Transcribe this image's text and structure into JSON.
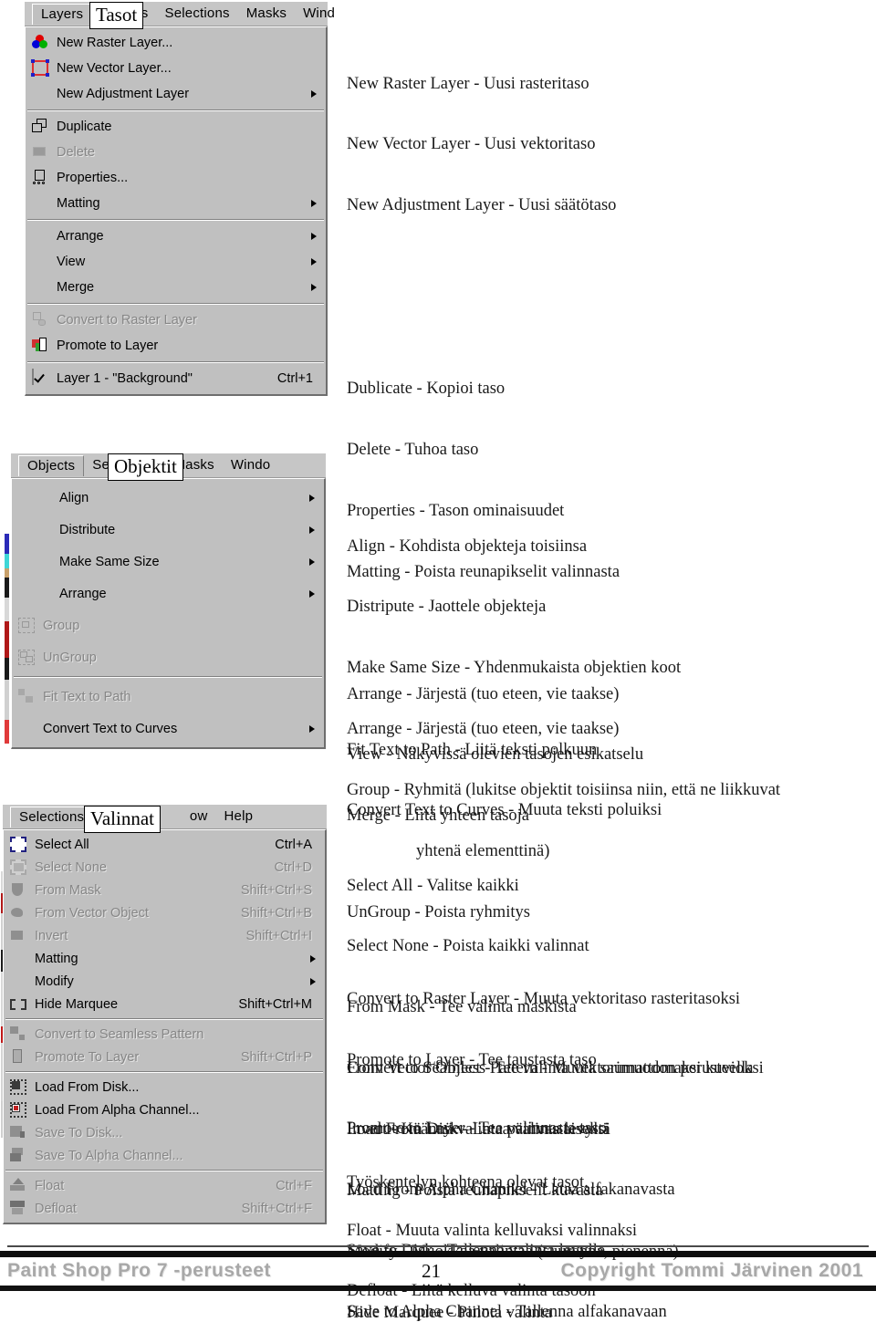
{
  "page": {
    "footer": {
      "left": "Paint Shop Pro 7 -perusteet",
      "page_number": "21",
      "right": "Copyright Tommi Järvinen 2001"
    }
  },
  "menus": [
    {
      "id": "layers",
      "menubar": {
        "items": [
          {
            "label": "Layers",
            "accel": "L",
            "active": true
          },
          {
            "label": "Objects",
            "accel": "O",
            "active": false
          },
          {
            "label": "Selections",
            "accel": "S",
            "active": false
          },
          {
            "label": "Masks",
            "accel": "M",
            "active": false
          },
          {
            "label": "Wind",
            "accel": "W",
            "active": false
          }
        ],
        "annotation": "Tasot"
      },
      "items": [
        {
          "label": "New Raster Layer...",
          "accel": "L",
          "icon": "raster-layer-icon",
          "shortcut": "",
          "submenu": false,
          "disabled": false
        },
        {
          "label": "New Vector Layer...",
          "accel": "V",
          "icon": "vector-layer-icon",
          "shortcut": "",
          "submenu": false,
          "disabled": false
        },
        {
          "label": "New Adjustment Layer",
          "accel": "A",
          "icon": "",
          "shortcut": "",
          "submenu": true,
          "disabled": false
        },
        {
          "separator": true
        },
        {
          "label": "Duplicate",
          "accel": "u",
          "icon": "duplicate-icon",
          "shortcut": "",
          "submenu": false,
          "disabled": false
        },
        {
          "label": "Delete",
          "accel": "D",
          "icon": "delete-icon",
          "shortcut": "",
          "submenu": false,
          "disabled": true
        },
        {
          "label": "Properties...",
          "accel": "P",
          "icon": "properties-icon",
          "shortcut": "",
          "submenu": false,
          "disabled": false
        },
        {
          "label": "Matting",
          "accel": "t",
          "icon": "",
          "shortcut": "",
          "submenu": true,
          "disabled": false
        },
        {
          "separator": true
        },
        {
          "label": "Arrange",
          "accel": "n",
          "icon": "",
          "shortcut": "",
          "submenu": true,
          "disabled": false
        },
        {
          "label": "View",
          "accel": "w",
          "icon": "",
          "shortcut": "",
          "submenu": true,
          "disabled": false
        },
        {
          "label": "Merge",
          "accel": "r",
          "icon": "",
          "shortcut": "",
          "submenu": true,
          "disabled": false
        },
        {
          "separator": true
        },
        {
          "label": "Convert to Raster Layer",
          "accel": "C",
          "icon": "convert-raster-icon",
          "shortcut": "",
          "submenu": false,
          "disabled": true
        },
        {
          "label": "Promote to Layer",
          "accel": "o",
          "icon": "promote-layer-icon",
          "shortcut": "",
          "submenu": false,
          "disabled": false
        },
        {
          "separator": true
        },
        {
          "label": "Layer 1 - \"Background\"",
          "accel": "1",
          "icon": "checkmark",
          "shortcut": "Ctrl+1",
          "submenu": false,
          "disabled": false
        }
      ],
      "descriptions": [
        "New Raster Layer - Uusi rasteritaso",
        "New Vector Layer - Uusi vektoritaso",
        "New Adjustment Layer - Uusi säätötaso",
        "",
        "",
        "Dublicate - Kopioi taso",
        "Delete - Tuhoa taso",
        "Properties - Tason ominaisuudet",
        "Matting - Poista reunapikselit valinnasta",
        "",
        "Arrange - Järjestä (tuo eteen, vie taakse)",
        "View - Näkyvissä olevien tasojen esikatselu",
        "Merge - Liitä yhteen tasoja",
        "",
        "",
        "Convert to Raster Layer - Muuta vektoritaso rasteritasoksi",
        "Promote to Layer - Tee taustasta taso",
        "",
        "Työskentelyn kohteena olevat tasot."
      ]
    },
    {
      "id": "objects",
      "menubar": {
        "items": [
          {
            "label": "Objects",
            "accel": "O",
            "active": true
          },
          {
            "label": "Selections",
            "accel": "g",
            "active": false
          },
          {
            "label": "Masks",
            "accel": "M",
            "active": false
          },
          {
            "label": "Windo",
            "accel": "W",
            "active": false
          }
        ],
        "annotation": "Objektit"
      },
      "items": [
        {
          "label": "Align",
          "accel": "A",
          "icon": "",
          "shortcut": "",
          "submenu": true,
          "disabled": false
        },
        {
          "label": "Distribute",
          "accel": "D",
          "icon": "",
          "shortcut": "",
          "submenu": true,
          "disabled": false
        },
        {
          "label": "Make Same Size",
          "accel": "z",
          "icon": "",
          "shortcut": "",
          "submenu": true,
          "disabled": false
        },
        {
          "label": "Arrange",
          "accel": "n",
          "icon": "",
          "shortcut": "",
          "submenu": true,
          "disabled": false
        },
        {
          "label": "Group",
          "accel": "G",
          "icon": "group-icon",
          "shortcut": "",
          "submenu": false,
          "disabled": true
        },
        {
          "label": "UnGroup",
          "accel": "U",
          "icon": "ungroup-icon",
          "shortcut": "",
          "submenu": false,
          "disabled": true
        },
        {
          "separator": true
        },
        {
          "label": "Fit Text to Path",
          "accel": "F",
          "icon": "fit-text-icon",
          "shortcut": "",
          "submenu": false,
          "disabled": true
        },
        {
          "label": "Convert Text to Curves",
          "accel": "o",
          "icon": "",
          "shortcut": "",
          "submenu": true,
          "disabled": false
        }
      ],
      "descriptions": [
        "Align - Kohdista objekteja toisiinsa",
        "Distripute - Jaottele objekteja",
        "Make Same Size - Yhdenmukaista objektien koot",
        "Arrange - Järjestä (tuo eteen, vie taakse)",
        "Group - Ryhmitä (lukitse objektit toisiinsa niin, että ne liikkuvat",
        "yhtenä elementtinä)",
        "UnGroup - Poista ryhmitys"
      ],
      "descriptions2": [
        "Fit Text to Path - Liitä teksti polkuun",
        "Convert Text to Curves - Muuta teksti poluiksi"
      ]
    },
    {
      "id": "selections",
      "menubar": {
        "items": [
          {
            "label": "Selections",
            "accel": "S",
            "active": true
          },
          {
            "label": "M",
            "accel": "M",
            "active": false
          },
          {
            "label": "ow",
            "accel": "",
            "active": false
          },
          {
            "label": "Help",
            "accel": "H",
            "active": false
          }
        ],
        "annotation": "Valinnat"
      },
      "items": [
        {
          "label": "Select All",
          "accel": "A",
          "icon": "select-all-icon",
          "shortcut": "Ctrl+A",
          "submenu": false,
          "disabled": false
        },
        {
          "label": "Select None",
          "accel": "N",
          "icon": "select-none-icon",
          "shortcut": "Ctrl+D",
          "submenu": false,
          "disabled": true
        },
        {
          "label": "From Mask",
          "accel": "r",
          "icon": "from-mask-icon",
          "shortcut": "Shift+Ctrl+S",
          "submenu": false,
          "disabled": true
        },
        {
          "label": "From Vector Object",
          "accel": "",
          "icon": "from-vector-icon",
          "shortcut": "Shift+Ctrl+B",
          "submenu": false,
          "disabled": true
        },
        {
          "label": "Invert",
          "accel": "I",
          "icon": "invert-icon",
          "shortcut": "Shift+Ctrl+I",
          "submenu": false,
          "disabled": true
        },
        {
          "label": "Matting",
          "accel": "t",
          "icon": "",
          "shortcut": "",
          "submenu": true,
          "disabled": false
        },
        {
          "label": "Modify",
          "accel": "o",
          "icon": "",
          "shortcut": "",
          "submenu": true,
          "disabled": false
        },
        {
          "label": "Hide Marquee",
          "accel": "H",
          "icon": "marquee-icon",
          "shortcut": "Shift+Ctrl+M",
          "submenu": false,
          "disabled": false
        },
        {
          "separator": true
        },
        {
          "label": "Convert to Seamless Pattern",
          "accel": "C",
          "icon": "seamless-pattern-icon",
          "shortcut": "",
          "submenu": false,
          "disabled": true
        },
        {
          "label": "Promote To Layer",
          "accel": "P",
          "icon": "promote-to-layer-icon",
          "shortcut": "Shift+Ctrl+P",
          "submenu": false,
          "disabled": true
        },
        {
          "separator": true
        },
        {
          "label": "Load From Disk...",
          "accel": "L",
          "icon": "load-from-disk-icon",
          "shortcut": "",
          "submenu": false,
          "disabled": false
        },
        {
          "label": "Load From Alpha Channel...",
          "accel": "o",
          "icon": "load-from-alpha-icon",
          "shortcut": "",
          "submenu": false,
          "disabled": false
        },
        {
          "label": "Save To Disk...",
          "accel": "S",
          "icon": "save-to-disk-icon",
          "shortcut": "",
          "submenu": false,
          "disabled": true
        },
        {
          "label": "Save To Alpha Channel...",
          "accel": "v",
          "icon": "save-to-alpha-icon",
          "shortcut": "",
          "submenu": false,
          "disabled": true
        },
        {
          "separator": true
        },
        {
          "label": "Float",
          "accel": "F",
          "icon": "float-icon",
          "shortcut": "Ctrl+F",
          "submenu": false,
          "disabled": true
        },
        {
          "label": "Defloat",
          "accel": "D",
          "icon": "defloat-icon",
          "shortcut": "Shift+Ctrl+F",
          "submenu": false,
          "disabled": true
        }
      ],
      "descriptions": [
        "Select All - Valitse kaikki",
        "Select None - Poista kaikki valinnat",
        "From Mask - Tee valinta maskista",
        "From Vector Object - Tee valinta vektorimuodon perusteella",
        "Invert - Käännä valinta päinvastaiseksi",
        "Matting - Poista reunapikselit kuvasta",
        "Modify - Muokkaa valintaa (suurenna, pienennä)",
        "Hide Marquee - Piilota valinta"
      ],
      "descriptions2": [
        "Convert to Seamless Pattern - Muuta saumattomaksi kuvioksi",
        "Promote to Layer - Tee valinnasta taso"
      ],
      "descriptions3": [
        "Load From Disk - Lataa valinta levyltä",
        "Load From Alpha Channel - Lataa alfakanavasta",
        "Save to Disk - Tallenna valinta levylle",
        "Save to Alpha Channel - Tallenna alfakanavaan"
      ],
      "descriptions4": [
        "Float - Muuta valinta kelluvaksi valinnaksi",
        "Defloat - Liitä kelluva valinta tasoon"
      ]
    }
  ]
}
